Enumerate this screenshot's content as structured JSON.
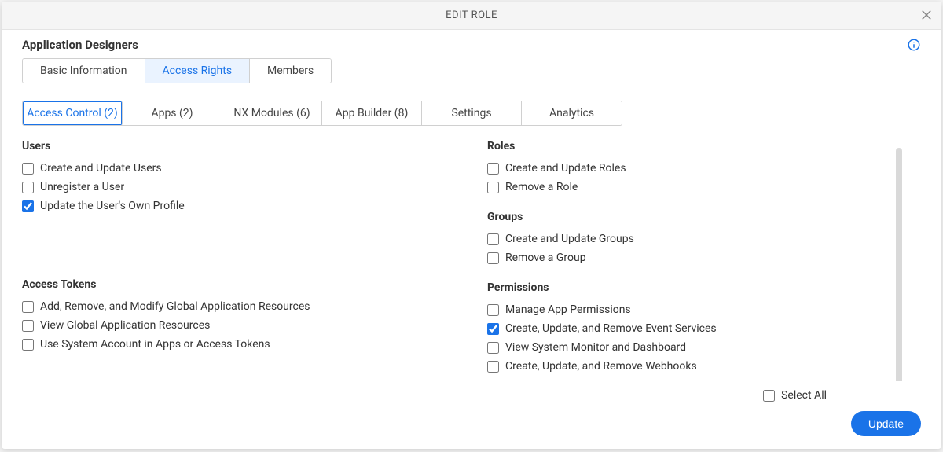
{
  "header": {
    "title": "EDIT ROLE"
  },
  "role_name": "Application Designers",
  "top_tabs": [
    {
      "label": "Basic Information",
      "active": false
    },
    {
      "label": "Access Rights",
      "active": true
    },
    {
      "label": "Members",
      "active": false
    }
  ],
  "sub_tabs": [
    {
      "label": "Access Control (2)",
      "active": true
    },
    {
      "label": "Apps (2)",
      "active": false
    },
    {
      "label": "NX Modules (6)",
      "active": false
    },
    {
      "label": "App Builder (8)",
      "active": false
    },
    {
      "label": "Settings",
      "active": false
    },
    {
      "label": "Analytics",
      "active": false
    }
  ],
  "left_column": [
    {
      "title": "Users",
      "items": [
        {
          "label": "Create and Update Users",
          "checked": false
        },
        {
          "label": "Unregister a User",
          "checked": false
        },
        {
          "label": "Update the User's Own Profile",
          "checked": true
        }
      ]
    },
    {
      "title": "Access Tokens",
      "items": [
        {
          "label": "Add, Remove, and Modify Global Application Resources",
          "checked": false
        },
        {
          "label": "View Global Application Resources",
          "checked": false
        },
        {
          "label": "Use System Account in Apps or Access Tokens",
          "checked": false
        }
      ]
    }
  ],
  "right_column": [
    {
      "title": "Roles",
      "items": [
        {
          "label": "Create and Update Roles",
          "checked": false
        },
        {
          "label": "Remove a Role",
          "checked": false
        }
      ]
    },
    {
      "title": "Groups",
      "items": [
        {
          "label": "Create and Update Groups",
          "checked": false
        },
        {
          "label": "Remove a Group",
          "checked": false
        }
      ]
    },
    {
      "title": "Permissions",
      "items": [
        {
          "label": "Manage App Permissions",
          "checked": false
        },
        {
          "label": "Create, Update, and Remove Event Services",
          "checked": true
        },
        {
          "label": "View System Monitor and Dashboard",
          "checked": false
        },
        {
          "label": "Create, Update, and Remove Webhooks",
          "checked": false
        }
      ]
    }
  ],
  "footer": {
    "select_all_label": "Select All",
    "select_all_checked": false,
    "update_label": "Update"
  }
}
